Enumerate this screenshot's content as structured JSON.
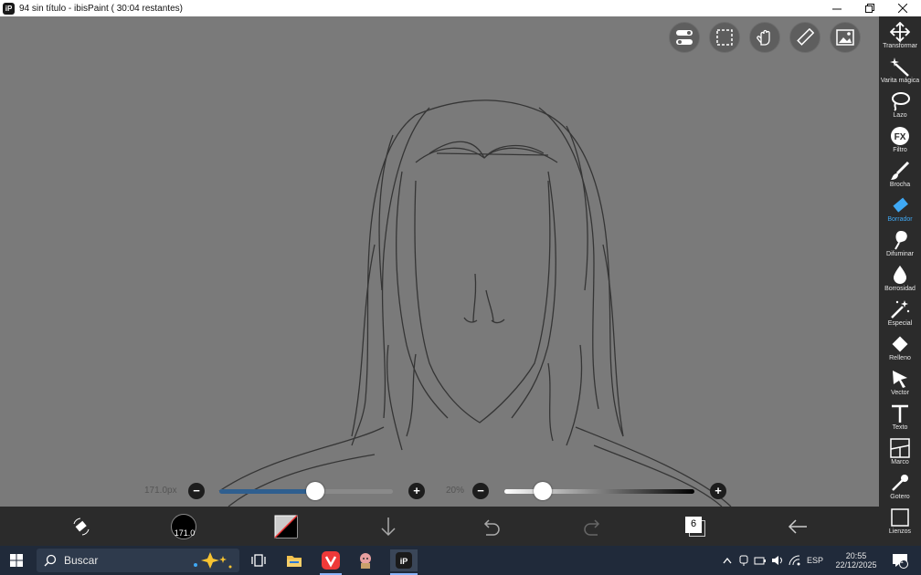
{
  "window": {
    "title": "94 sin título - ibisPaint ( 30:04 restantes)",
    "app_icon_text": "iP",
    "controls": [
      "minimize-icon",
      "restore-icon",
      "close-icon"
    ]
  },
  "top_buttons": [
    "toggle-settings-icon",
    "selection-icon",
    "hand-icon",
    "ruler-icon",
    "image-icon"
  ],
  "tools": [
    {
      "label": "Transformar",
      "icon": "move-icon"
    },
    {
      "label": "Varita mágica",
      "icon": "magic-wand-icon"
    },
    {
      "label": "Lazo",
      "icon": "lasso-icon"
    },
    {
      "label": "Filtro",
      "icon": "fx-icon"
    },
    {
      "label": "Brocha",
      "icon": "brush-icon"
    },
    {
      "label": "Borrador",
      "icon": "eraser-icon",
      "active": true
    },
    {
      "label": "Difuminar",
      "icon": "smudge-icon"
    },
    {
      "label": "Borrosidad",
      "icon": "blur-drop-icon"
    },
    {
      "label": "Especial",
      "icon": "special-wand-icon"
    },
    {
      "label": "Relleno",
      "icon": "fill-bucket-icon"
    },
    {
      "label": "Vector",
      "icon": "vector-arrow-icon"
    },
    {
      "label": "Texto",
      "icon": "text-icon"
    },
    {
      "label": "Marco",
      "icon": "frame-icon"
    },
    {
      "label": "Gotero",
      "icon": "eyedropper-icon"
    },
    {
      "label": "Lienzos",
      "icon": "canvas-icon"
    }
  ],
  "size_slider": {
    "label": "171.0px",
    "value_fraction": 0.55
  },
  "opacity_slider": {
    "label": "20%",
    "value_fraction": 0.2
  },
  "bottom_bar": {
    "brush_size_display": "171.0",
    "layer_count": "6",
    "buttons": [
      "eraser-swap-icon",
      "brush-size-preview",
      "color-swatch",
      "download-icon",
      "undo-icon",
      "redo-icon",
      "layers-icon",
      "back-arrow-icon"
    ]
  },
  "taskbar": {
    "search_placeholder": "Buscar",
    "language": "ESP",
    "time": "20:55",
    "date": "22/12/2025",
    "notification_count": "1"
  },
  "colors": {
    "accent": "#3fa9f5",
    "canvas_bg": "#7a7a7a",
    "toolbar_bg": "#2b2b2b",
    "taskbar_bg": "#202a3a",
    "size_slider_fill": "#2f5f8f"
  }
}
